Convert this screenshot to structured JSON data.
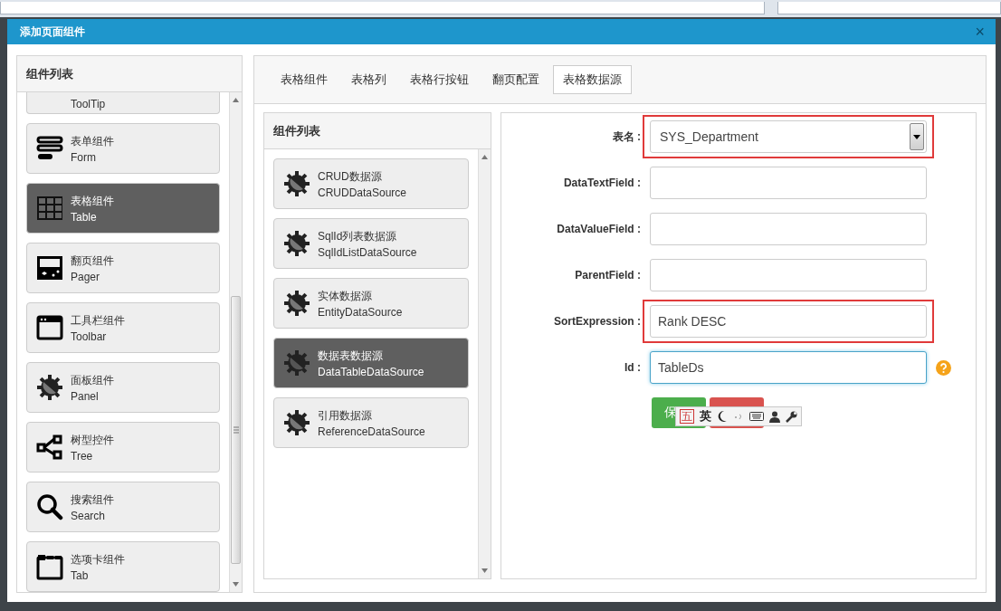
{
  "dialog": {
    "title": "添加页面组件",
    "close": "×"
  },
  "component_panel": {
    "title": "组件列表",
    "items": [
      {
        "code": "ToolTip",
        "kind": "gear",
        "selected": false,
        "partial": true
      },
      {
        "name": "表单组件",
        "code": "Form",
        "kind": "form",
        "selected": false,
        "partial": false
      },
      {
        "name": "表格组件",
        "code": "Table",
        "kind": "table",
        "selected": true,
        "partial": false
      },
      {
        "name": "翻页组件",
        "code": "Pager",
        "kind": "pager",
        "selected": false,
        "partial": false
      },
      {
        "name": "工具栏组件",
        "code": "Toolbar",
        "kind": "window",
        "selected": false,
        "partial": false
      },
      {
        "name": "面板组件",
        "code": "Panel",
        "kind": "gear",
        "selected": false,
        "partial": false
      },
      {
        "name": "树型控件",
        "code": "Tree",
        "kind": "tree",
        "selected": false,
        "partial": false
      },
      {
        "name": "搜索组件",
        "code": "Search",
        "kind": "search",
        "selected": false,
        "partial": false
      },
      {
        "name": "选项卡组件",
        "code": "Tab",
        "kind": "tabs",
        "selected": false,
        "partial": false
      }
    ]
  },
  "tabs": [
    {
      "label": "表格组件",
      "selected": false
    },
    {
      "label": "表格列",
      "selected": false
    },
    {
      "label": "表格行按钮",
      "selected": false
    },
    {
      "label": "翻页配置",
      "selected": false
    },
    {
      "label": "表格数据源",
      "selected": true
    }
  ],
  "datasource_panel": {
    "title": "组件列表",
    "items": [
      {
        "name": "CRUD数据源",
        "code": "CRUDDataSource",
        "selected": false
      },
      {
        "name": "SqlId列表数据源",
        "code": "SqlIdListDataSource",
        "selected": false
      },
      {
        "name": "实体数据源",
        "code": "EntityDataSource",
        "selected": false
      },
      {
        "name": "数据表数据源",
        "code": "DataTableDataSource",
        "selected": true
      },
      {
        "name": "引用数据源",
        "code": "ReferenceDataSource",
        "selected": false
      }
    ]
  },
  "form": {
    "fields": [
      {
        "label": "表名 :",
        "kind": "select",
        "value": "SYS_Department",
        "highlighted": true,
        "focused": false
      },
      {
        "label": "DataTextField :",
        "kind": "text",
        "highlighted": false,
        "focused": false
      },
      {
        "label": "DataValueField :",
        "kind": "text",
        "highlighted": false,
        "focused": false
      },
      {
        "label": "ParentField :",
        "kind": "text",
        "highlighted": false,
        "focused": false
      },
      {
        "label": "SortExpression :",
        "kind": "text",
        "value": "Rank DESC",
        "highlighted": true,
        "focused": false
      },
      {
        "label": "Id :",
        "kind": "text",
        "value": "TableDs",
        "highlighted": false,
        "focused": true,
        "help": true
      }
    ],
    "buttons": [
      {
        "label": "保",
        "kind": "save"
      },
      {
        "kind": "cancel"
      }
    ]
  },
  "ime_toolbar": {
    "mode_key": "五",
    "language": "英"
  }
}
